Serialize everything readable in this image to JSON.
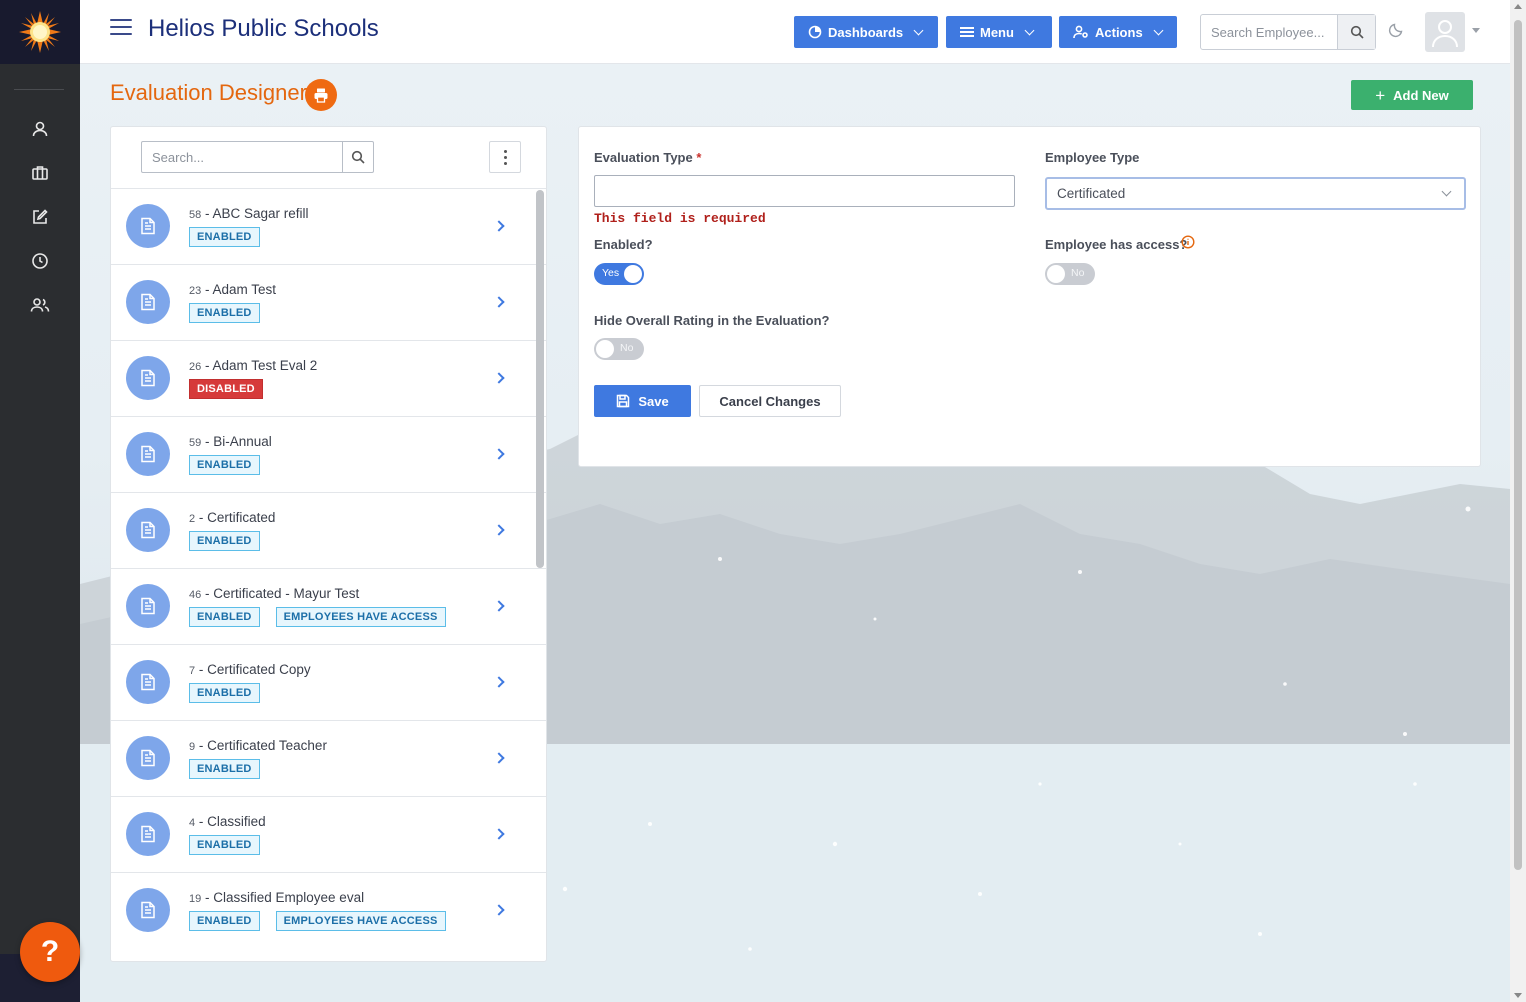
{
  "app": {
    "title": "Helios Public Schools"
  },
  "topbar": {
    "dashboards_label": "Dashboards",
    "menu_label": "Menu",
    "actions_label": "Actions",
    "search_placeholder": "Search Employee..."
  },
  "page": {
    "title": "Evaluation Designer",
    "add_new_label": "Add New"
  },
  "list": {
    "search_placeholder": "Search...",
    "items": [
      {
        "num": "58",
        "name": "ABC Sagar refill",
        "badges": [
          "ENABLED"
        ]
      },
      {
        "num": "23",
        "name": "Adam Test",
        "badges": [
          "ENABLED"
        ]
      },
      {
        "num": "26",
        "name": "Adam Test Eval 2",
        "badges": [
          "DISABLED"
        ]
      },
      {
        "num": "59",
        "name": "Bi-Annual",
        "badges": [
          "ENABLED"
        ]
      },
      {
        "num": "2",
        "name": "Certificated",
        "badges": [
          "ENABLED"
        ]
      },
      {
        "num": "46",
        "name": "Certificated - Mayur Test",
        "badges": [
          "ENABLED",
          "EMPLOYEES HAVE ACCESS"
        ]
      },
      {
        "num": "7",
        "name": "Certificated Copy",
        "badges": [
          "ENABLED"
        ]
      },
      {
        "num": "9",
        "name": "Certificated Teacher",
        "badges": [
          "ENABLED"
        ]
      },
      {
        "num": "4",
        "name": "Classified",
        "badges": [
          "ENABLED"
        ]
      },
      {
        "num": "19",
        "name": "Classified Employee eval",
        "badges": [
          "ENABLED",
          "EMPLOYEES HAVE ACCESS"
        ]
      }
    ]
  },
  "form": {
    "evaluation_type_label": "Evaluation Type",
    "required_mark": "*",
    "evaluation_type_value": "",
    "error_text": "This field is required",
    "employee_type_label": "Employee Type",
    "employee_type_value": "Certificated",
    "enabled_label": "Enabled?",
    "enabled_toggle": "Yes",
    "employee_access_label": "Employee has access?",
    "employee_access_toggle": "No",
    "hide_rating_label": "Hide Overall Rating in the Evaluation?",
    "hide_rating_toggle": "No",
    "save_label": "Save",
    "cancel_label": "Cancel Changes"
  },
  "help": {
    "label": "?"
  },
  "colors": {
    "primary": "#3f79e0",
    "accent_orange": "#ef6a12",
    "success": "#3bb06e",
    "danger": "#d63a3a",
    "rail": "#2b2d30"
  }
}
